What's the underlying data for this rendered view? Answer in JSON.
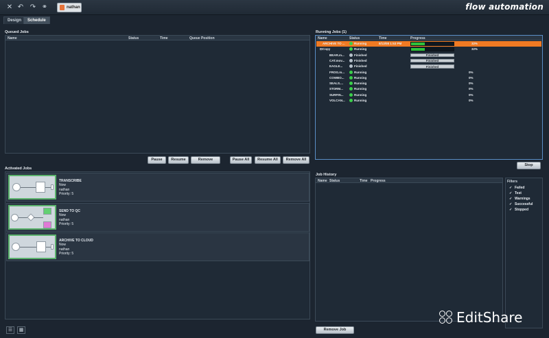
{
  "toolbar": {
    "icons": [
      "close-icon",
      "undo-icon",
      "redo-icon",
      "link-icon"
    ],
    "user": "nathan",
    "brand": "flow automation"
  },
  "tabs": [
    {
      "label": "Design",
      "active": false
    },
    {
      "label": "Schedule",
      "active": true
    }
  ],
  "queued_jobs": {
    "title": "Queued Jobs",
    "columns": [
      "Name",
      "Status",
      "Time",
      "Queue Position"
    ],
    "buttons": {
      "pause": "Pause",
      "resume": "Resume",
      "remove": "Remove",
      "pause_all": "Pause All",
      "resume_all": "Resume All",
      "remove_all": "Remove All"
    }
  },
  "running_jobs": {
    "title": "Running Jobs (1)",
    "columns": [
      "Name",
      "Status",
      "Time",
      "Progress"
    ],
    "rows": [
      {
        "name": "ARCHIVE TO ...",
        "status": "Running",
        "time": "8/13/08 1:53 PM",
        "progress": 0.32,
        "label": "32%",
        "selected": true
      },
      {
        "name": "Copy",
        "status": "Running",
        "time": "",
        "progress": 0.32,
        "label": "32%",
        "selected": false
      },
      {
        "name": "BEAR.m...",
        "status": "Finished",
        "time": "",
        "progress": 1,
        "label": "Finished",
        "selected": false
      },
      {
        "name": "CAT.mov...",
        "status": "Finished",
        "time": "",
        "progress": 1,
        "label": "Finished",
        "selected": false
      },
      {
        "name": "EAGLE...",
        "status": "Finished",
        "time": "",
        "progress": 1,
        "label": "Finished",
        "selected": false
      },
      {
        "name": "FROG.m...",
        "status": "Running",
        "time": "",
        "progress": 0,
        "label": "0%",
        "selected": false
      },
      {
        "name": "COWBO...",
        "status": "Running",
        "time": "",
        "progress": 0,
        "label": "0%",
        "selected": false
      },
      {
        "name": "SEALS....",
        "status": "Running",
        "time": "",
        "progress": 0,
        "label": "0%",
        "selected": false
      },
      {
        "name": "STORM...",
        "status": "Running",
        "time": "",
        "progress": 0,
        "label": "0%",
        "selected": false
      },
      {
        "name": "SURFIN...",
        "status": "Running",
        "time": "",
        "progress": 0,
        "label": "0%",
        "selected": false
      },
      {
        "name": "VOLCAN...",
        "status": "Running",
        "time": "",
        "progress": 0,
        "label": "0%",
        "selected": false
      }
    ],
    "stop": "Stop"
  },
  "activated_jobs": {
    "title": "Activated Jobs",
    "jobs": [
      {
        "title": "TRANSCRIBE",
        "when": "Now",
        "user": "nathan",
        "priority": "Priority: 5"
      },
      {
        "title": "SEND TO QC",
        "when": "Now",
        "user": "nathan",
        "priority": "Priority: 5"
      },
      {
        "title": "ARCHIVE TO CLOUD",
        "when": "Now",
        "user": "nathan",
        "priority": "Priority: 5"
      }
    ]
  },
  "job_history": {
    "title": "Job History",
    "columns": [
      "Name",
      "Status",
      "Time",
      "Progress"
    ],
    "remove": "Remove Job"
  },
  "filters": {
    "title": "Filters",
    "items": [
      "Failed",
      "Test",
      "Warnings",
      "Successful",
      "Stopped"
    ]
  },
  "watermark": "EditShare",
  "colors": {
    "accent": "#f07a23",
    "running": "#3ad04a",
    "background": "#1c2530"
  }
}
